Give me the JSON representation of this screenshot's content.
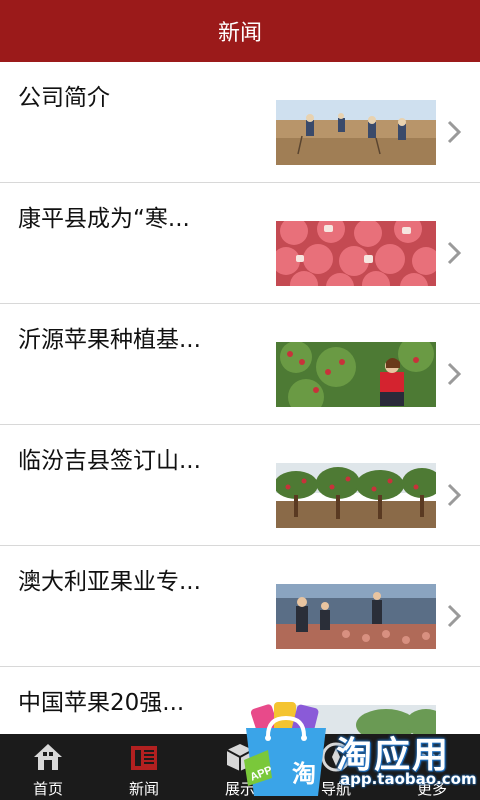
{
  "header": {
    "title": "新闻"
  },
  "news": [
    {
      "title": "公司简介",
      "image": "farm-workers-field"
    },
    {
      "title": "康平县成为“寒...",
      "image": "apples-closeup"
    },
    {
      "title": "沂源苹果种植基...",
      "image": "woman-picking-apples"
    },
    {
      "title": "临汾吉县签订山...",
      "image": "orchard-rows"
    },
    {
      "title": "澳大利亚果业专...",
      "image": "greenhouse-workers"
    },
    {
      "title": "中国苹果20强...",
      "image": "orchard-partial"
    }
  ],
  "tabbar": {
    "tabs": [
      {
        "label": "首页",
        "icon": "home-icon"
      },
      {
        "label": "新闻",
        "icon": "news-icon"
      },
      {
        "label": "展示",
        "icon": "box-icon"
      },
      {
        "label": "导航",
        "icon": "compass-icon"
      },
      {
        "label": "更多",
        "icon": "more-icon"
      }
    ]
  },
  "overlay": {
    "brand": "淘应用",
    "url": "app.taobao.com",
    "badge_text": "APP",
    "bag_char": "淘"
  },
  "colors": {
    "header_bg": "#9b1a1a",
    "tabbar_bg": "#1b1b1b",
    "active_icon": "#b22020",
    "overlay_blue": "#1f6fbf"
  }
}
